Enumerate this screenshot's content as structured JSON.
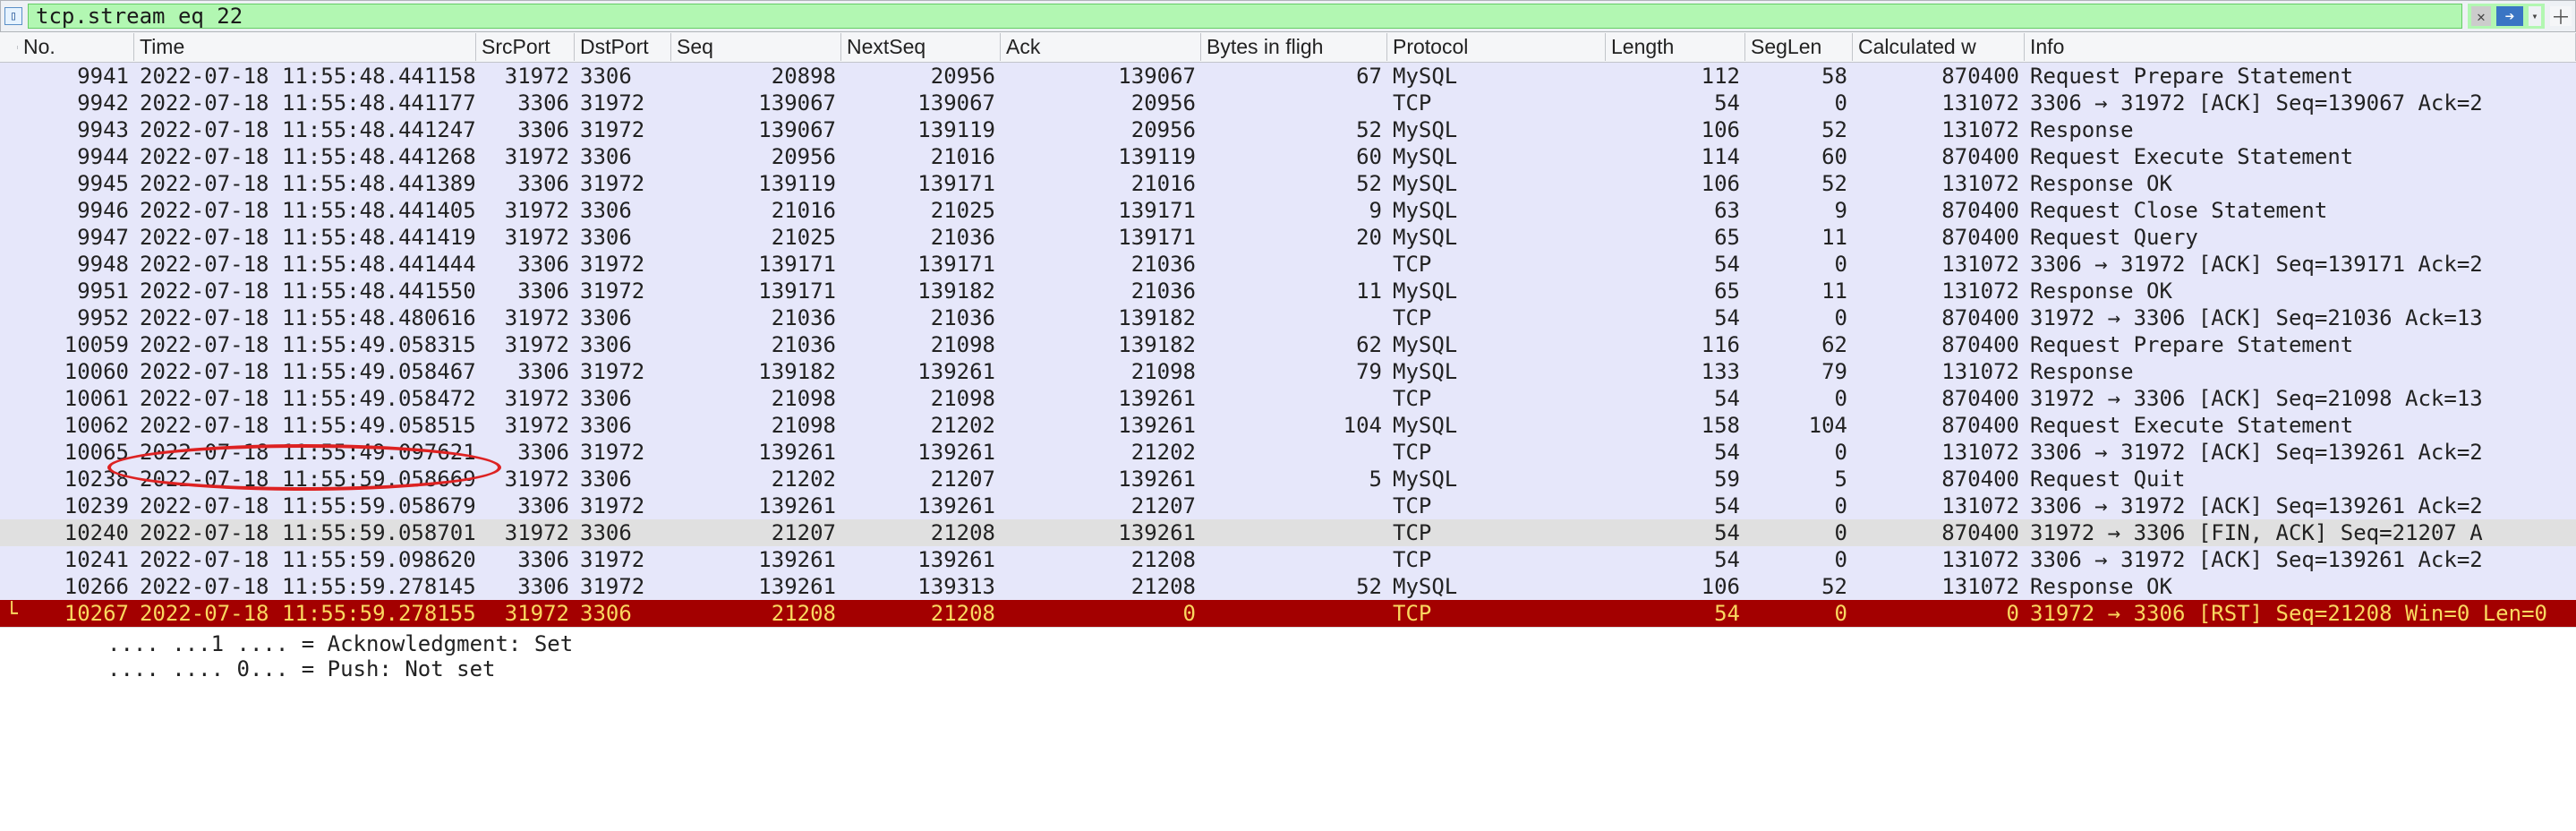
{
  "filter": {
    "value": "tcp.stream eq 22"
  },
  "columns": {
    "no": "No.",
    "time": "Time",
    "src_port": "SrcPort",
    "dst_port": "DstPort",
    "seq": "Seq",
    "next_seq": "NextSeq",
    "ack": "Ack",
    "bytes_in_flight": "Bytes in fligh",
    "protocol": "Protocol",
    "length": "Length",
    "seg_len": "SegLen",
    "calculated_w": "Calculated w",
    "info": "Info"
  },
  "rows": [
    {
      "no": "9941",
      "time": "2022-07-18 11:55:48.441158",
      "sport": "31972",
      "dport": "3306",
      "seq": "20898",
      "nseq": "20956",
      "ack": "139067",
      "bif": "67",
      "proto": "MySQL",
      "len": "112",
      "seglen": "58",
      "calcw": "870400",
      "info": "Request Prepare Statement"
    },
    {
      "no": "9942",
      "time": "2022-07-18 11:55:48.441177",
      "sport": "3306",
      "dport": "31972",
      "seq": "139067",
      "nseq": "139067",
      "ack": "20956",
      "bif": "",
      "proto": "TCP",
      "len": "54",
      "seglen": "0",
      "calcw": "131072",
      "info": "3306 → 31972 [ACK] Seq=139067 Ack=2"
    },
    {
      "no": "9943",
      "time": "2022-07-18 11:55:48.441247",
      "sport": "3306",
      "dport": "31972",
      "seq": "139067",
      "nseq": "139119",
      "ack": "20956",
      "bif": "52",
      "proto": "MySQL",
      "len": "106",
      "seglen": "52",
      "calcw": "131072",
      "info": "Response"
    },
    {
      "no": "9944",
      "time": "2022-07-18 11:55:48.441268",
      "sport": "31972",
      "dport": "3306",
      "seq": "20956",
      "nseq": "21016",
      "ack": "139119",
      "bif": "60",
      "proto": "MySQL",
      "len": "114",
      "seglen": "60",
      "calcw": "870400",
      "info": "Request Execute Statement"
    },
    {
      "no": "9945",
      "time": "2022-07-18 11:55:48.441389",
      "sport": "3306",
      "dport": "31972",
      "seq": "139119",
      "nseq": "139171",
      "ack": "21016",
      "bif": "52",
      "proto": "MySQL",
      "len": "106",
      "seglen": "52",
      "calcw": "131072",
      "info": "Response  OK"
    },
    {
      "no": "9946",
      "time": "2022-07-18 11:55:48.441405",
      "sport": "31972",
      "dport": "3306",
      "seq": "21016",
      "nseq": "21025",
      "ack": "139171",
      "bif": "9",
      "proto": "MySQL",
      "len": "63",
      "seglen": "9",
      "calcw": "870400",
      "info": "Request Close Statement"
    },
    {
      "no": "9947",
      "time": "2022-07-18 11:55:48.441419",
      "sport": "31972",
      "dport": "3306",
      "seq": "21025",
      "nseq": "21036",
      "ack": "139171",
      "bif": "20",
      "proto": "MySQL",
      "len": "65",
      "seglen": "11",
      "calcw": "870400",
      "info": "Request Query"
    },
    {
      "no": "9948",
      "time": "2022-07-18 11:55:48.441444",
      "sport": "3306",
      "dport": "31972",
      "seq": "139171",
      "nseq": "139171",
      "ack": "21036",
      "bif": "",
      "proto": "TCP",
      "len": "54",
      "seglen": "0",
      "calcw": "131072",
      "info": "3306 → 31972 [ACK] Seq=139171 Ack=2"
    },
    {
      "no": "9951",
      "time": "2022-07-18 11:55:48.441550",
      "sport": "3306",
      "dport": "31972",
      "seq": "139171",
      "nseq": "139182",
      "ack": "21036",
      "bif": "11",
      "proto": "MySQL",
      "len": "65",
      "seglen": "11",
      "calcw": "131072",
      "info": "Response  OK"
    },
    {
      "no": "9952",
      "time": "2022-07-18 11:55:48.480616",
      "sport": "31972",
      "dport": "3306",
      "seq": "21036",
      "nseq": "21036",
      "ack": "139182",
      "bif": "",
      "proto": "TCP",
      "len": "54",
      "seglen": "0",
      "calcw": "870400",
      "info": "31972 → 3306 [ACK] Seq=21036 Ack=13"
    },
    {
      "no": "10059",
      "time": "2022-07-18 11:55:49.058315",
      "sport": "31972",
      "dport": "3306",
      "seq": "21036",
      "nseq": "21098",
      "ack": "139182",
      "bif": "62",
      "proto": "MySQL",
      "len": "116",
      "seglen": "62",
      "calcw": "870400",
      "info": "Request Prepare Statement"
    },
    {
      "no": "10060",
      "time": "2022-07-18 11:55:49.058467",
      "sport": "3306",
      "dport": "31972",
      "seq": "139182",
      "nseq": "139261",
      "ack": "21098",
      "bif": "79",
      "proto": "MySQL",
      "len": "133",
      "seglen": "79",
      "calcw": "131072",
      "info": "Response"
    },
    {
      "no": "10061",
      "time": "2022-07-18 11:55:49.058472",
      "sport": "31972",
      "dport": "3306",
      "seq": "21098",
      "nseq": "21098",
      "ack": "139261",
      "bif": "",
      "proto": "TCP",
      "len": "54",
      "seglen": "0",
      "calcw": "870400",
      "info": "31972 → 3306 [ACK] Seq=21098 Ack=13"
    },
    {
      "no": "10062",
      "time": "2022-07-18 11:55:49.058515",
      "sport": "31972",
      "dport": "3306",
      "seq": "21098",
      "nseq": "21202",
      "ack": "139261",
      "bif": "104",
      "proto": "MySQL",
      "len": "158",
      "seglen": "104",
      "calcw": "870400",
      "info": "Request Execute Statement"
    },
    {
      "no": "10065",
      "time": "2022-07-18 11:55:49.097621",
      "sport": "3306",
      "dport": "31972",
      "seq": "139261",
      "nseq": "139261",
      "ack": "21202",
      "bif": "",
      "proto": "TCP",
      "len": "54",
      "seglen": "0",
      "calcw": "131072",
      "info": "3306 → 31972 [ACK] Seq=139261 Ack=2"
    },
    {
      "no": "10238",
      "time": "2022-07-18 11:55:59.058669",
      "sport": "31972",
      "dport": "3306",
      "seq": "21202",
      "nseq": "21207",
      "ack": "139261",
      "bif": "5",
      "proto": "MySQL",
      "len": "59",
      "seglen": "5",
      "calcw": "870400",
      "info": "Request Quit"
    },
    {
      "no": "10239",
      "time": "2022-07-18 11:55:59.058679",
      "sport": "3306",
      "dport": "31972",
      "seq": "139261",
      "nseq": "139261",
      "ack": "21207",
      "bif": "",
      "proto": "TCP",
      "len": "54",
      "seglen": "0",
      "calcw": "131072",
      "info": "3306 → 31972 [ACK] Seq=139261 Ack=2"
    },
    {
      "no": "10240",
      "time": "2022-07-18 11:55:59.058701",
      "sport": "31972",
      "dport": "3306",
      "seq": "21207",
      "nseq": "21208",
      "ack": "139261",
      "bif": "",
      "proto": "TCP",
      "len": "54",
      "seglen": "0",
      "calcw": "870400",
      "info": "31972 → 3306 [FIN, ACK] Seq=21207 A",
      "sel": true
    },
    {
      "no": "10241",
      "time": "2022-07-18 11:55:59.098620",
      "sport": "3306",
      "dport": "31972",
      "seq": "139261",
      "nseq": "139261",
      "ack": "21208",
      "bif": "",
      "proto": "TCP",
      "len": "54",
      "seglen": "0",
      "calcw": "131072",
      "info": "3306 → 31972 [ACK] Seq=139261 Ack=2"
    },
    {
      "no": "10266",
      "time": "2022-07-18 11:55:59.278145",
      "sport": "3306",
      "dport": "31972",
      "seq": "139261",
      "nseq": "139313",
      "ack": "21208",
      "bif": "52",
      "proto": "MySQL",
      "len": "106",
      "seglen": "52",
      "calcw": "131072",
      "info": "Response  OK"
    },
    {
      "no": "10267",
      "time": "2022-07-18 11:55:59.278155",
      "sport": "31972",
      "dport": "3306",
      "seq": "21208",
      "nseq": "21208",
      "ack": "0",
      "bif": "",
      "proto": "TCP",
      "len": "54",
      "seglen": "0",
      "calcw": "0",
      "info": "31972 → 3306 [RST] Seq=21208 Win=0 Len=0",
      "red": true,
      "marker": "└"
    }
  ],
  "details": {
    "line1": ".... ...1 .... = Acknowledgment: Set",
    "line2": ".... .... 0... = Push: Not set"
  }
}
